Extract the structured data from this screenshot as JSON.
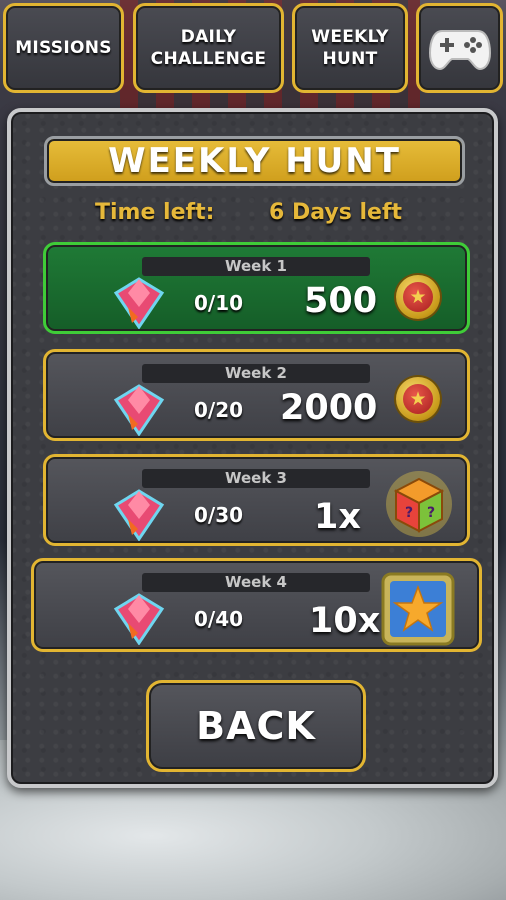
{
  "tabs": {
    "missions": "MISSIONS",
    "daily_line1": "DAILY",
    "daily_line2": "CHALLENGE",
    "weekly_line1": "WEEKLY",
    "weekly_line2": "HUNT",
    "game_icon": "gamepad-icon"
  },
  "panel": {
    "title": "WEEKLY HUNT",
    "time_label": "Time left:",
    "time_value": "6 Days left"
  },
  "weeks": [
    {
      "label": "Week 1",
      "progress": "0/10",
      "reward": "500",
      "reward_icon": "coin-icon",
      "active": true
    },
    {
      "label": "Week 2",
      "progress": "0/20",
      "reward": "2000",
      "reward_icon": "coin-icon",
      "active": false
    },
    {
      "label": "Week 3",
      "progress": "0/30",
      "reward": "1x",
      "reward_icon": "mystery-box-icon",
      "active": false
    },
    {
      "label": "Week 4",
      "progress": "0/40",
      "reward": "10x",
      "reward_icon": "star-icon",
      "active": false
    }
  ],
  "back_button": "BACK",
  "colors": {
    "accent_gold": "#e2b532",
    "active_green": "#3fcc38",
    "time_text": "#e6b83a"
  }
}
